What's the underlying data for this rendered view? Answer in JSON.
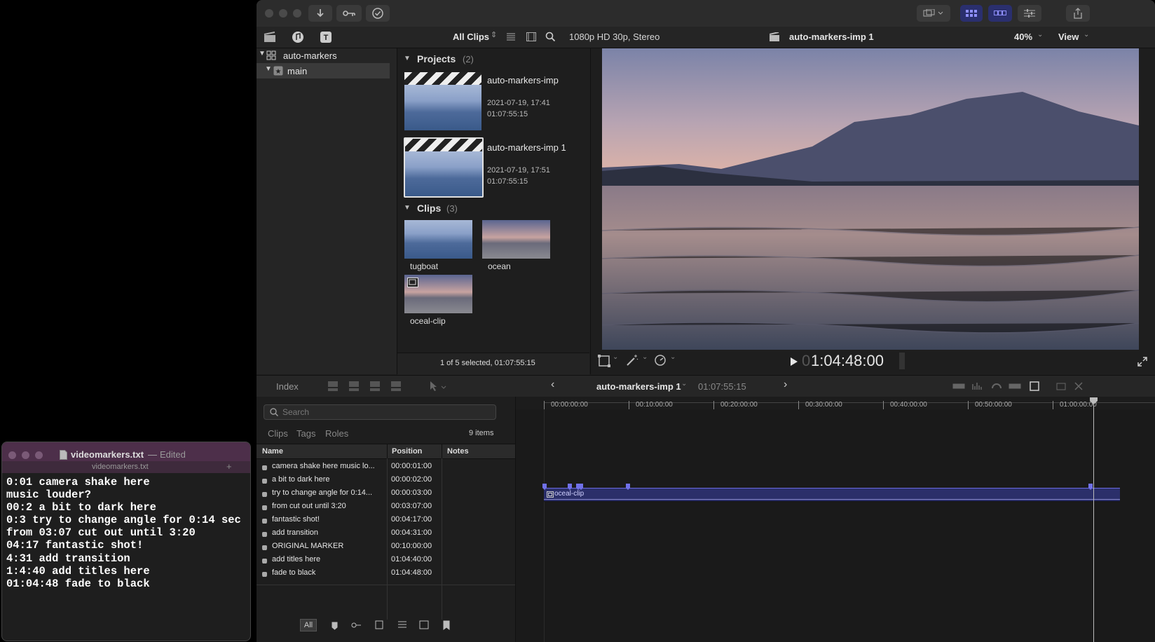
{
  "fcp": {
    "browser_filter": "All Clips",
    "format_info": "1080p HD 30p, Stereo",
    "viewer_title": "auto-markers-imp 1",
    "zoom": "40%",
    "view_menu": "View",
    "library": {
      "name": "auto-markers",
      "event": "main"
    },
    "projects_header": "Projects",
    "projects_count": "(2)",
    "projects": [
      {
        "name": "auto-markers-imp",
        "date": "2021-07-19, 17:41",
        "duration": "01:07:55:15"
      },
      {
        "name": "auto-markers-imp 1",
        "date": "2021-07-19, 17:51",
        "duration": "01:07:55:15"
      }
    ],
    "clips_header": "Clips",
    "clips_count": "(3)",
    "clips": [
      {
        "name": "tugboat"
      },
      {
        "name": "ocean"
      },
      {
        "name": "oceal-clip"
      }
    ],
    "selection_status": "1 of 5 selected, 01:07:55:15",
    "timecode_prefix": "0",
    "timecode": "1:04:48:00",
    "index_tab": "Index",
    "timeline_project": "auto-markers-imp 1",
    "timeline_duration": "01:07:55:15",
    "search_placeholder": "Search",
    "index_tabs": [
      "Clips",
      "Tags",
      "Roles"
    ],
    "items_count": "9 items",
    "columns": {
      "name": "Name",
      "position": "Position",
      "notes": "Notes"
    },
    "markers": [
      {
        "name": "camera shake here music lo...",
        "position": "00:00:01:00"
      },
      {
        "name": "a bit to dark here",
        "position": "00:00:02:00"
      },
      {
        "name": "try to change angle for 0:14...",
        "position": "00:00:03:00"
      },
      {
        "name": "from cut out until 3:20",
        "position": "00:03:07:00"
      },
      {
        "name": "fantastic shot!",
        "position": "00:04:17:00"
      },
      {
        "name": "add transition",
        "position": "00:04:31:00"
      },
      {
        "name": "ORIGINAL MARKER",
        "position": "00:10:00:00"
      },
      {
        "name": "add titles here",
        "position": "01:04:40:00"
      },
      {
        "name": "fade to black",
        "position": "01:04:48:00"
      }
    ],
    "filter_all": "All",
    "ruler_labels": [
      "00:00:00:00",
      "00:10:00:00",
      "00:20:00:00",
      "00:30:00:00",
      "00:40:00:00",
      "00:50:00:00",
      "01:00:00:00"
    ],
    "timeline_clip": "oceal-clip"
  },
  "editor": {
    "title": "videomarkers.txt",
    "title_sep": "—",
    "edited": "Edited",
    "tab": "videomarkers.txt",
    "lines": [
      "0:01 camera shake here",
      "music louder?",
      "00:2 a bit to dark here",
      "0:3 try to change angle for 0:14 sec",
      "from 03:07 cut out until 3:20",
      "04:17 fantastic shot!",
      "4:31 add transition",
      "1:4:40 add titles here",
      "01:04:48 fade to black"
    ]
  },
  "colors": {
    "accent": "#5b5bd6",
    "selection": "#3a3a3a"
  }
}
